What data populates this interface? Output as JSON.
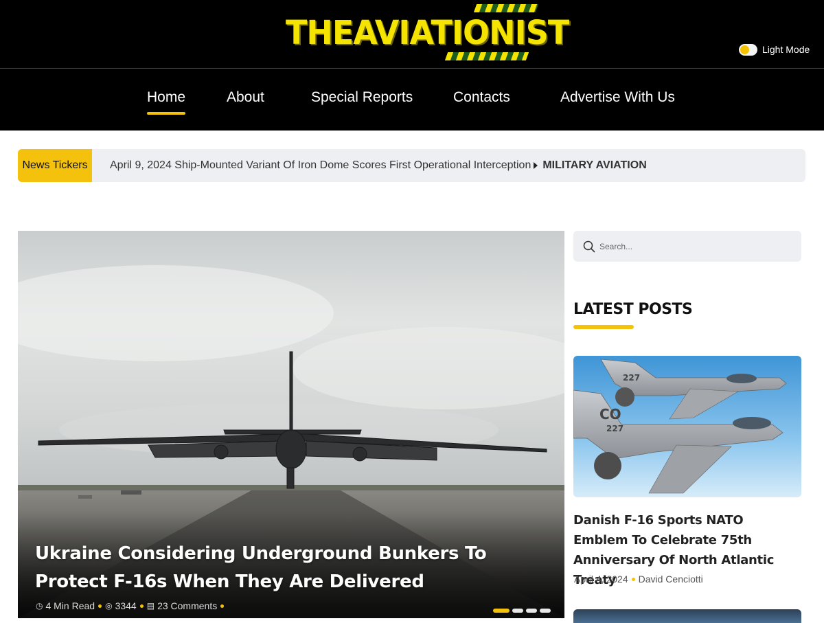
{
  "header": {
    "logo_text": "THEAVIATIONIST",
    "mode_label": "Light Mode"
  },
  "nav": {
    "items": [
      {
        "label": "Home",
        "active": true
      },
      {
        "label": "About",
        "active": false
      },
      {
        "label": "Special Reports",
        "active": false
      },
      {
        "label": "Contacts",
        "active": false
      },
      {
        "label": "Advertise With Us",
        "active": false
      }
    ]
  },
  "ticker": {
    "label": "News Tickers",
    "text": "April 9, 2024 Ship-Mounted Variant Of Iron Dome Scores First Operational Interception",
    "category": "MILITARY AVIATION"
  },
  "hero": {
    "title": "Ukraine Considering Underground Bunkers To Protect F-16s When They Are Delivered",
    "read_time": "4 Min Read",
    "views": "3344",
    "comments": "23 Comments",
    "slides": 4,
    "active_slide": 1
  },
  "sidebar": {
    "search_placeholder": "Search...",
    "latest_heading": "LATEST POSTS",
    "posts": [
      {
        "title": "Danish F-16 Sports NATO Emblem To Celebrate 75th Anniversary Of North Atlantic Treaty",
        "date": "April 4, 2024",
        "author": "David Cenciotti",
        "tail_code": "CO",
        "serial": "227"
      }
    ]
  },
  "colors": {
    "accent": "#f4c20d",
    "header_bg": "#000000",
    "ticker_bg": "#eeeff2"
  }
}
